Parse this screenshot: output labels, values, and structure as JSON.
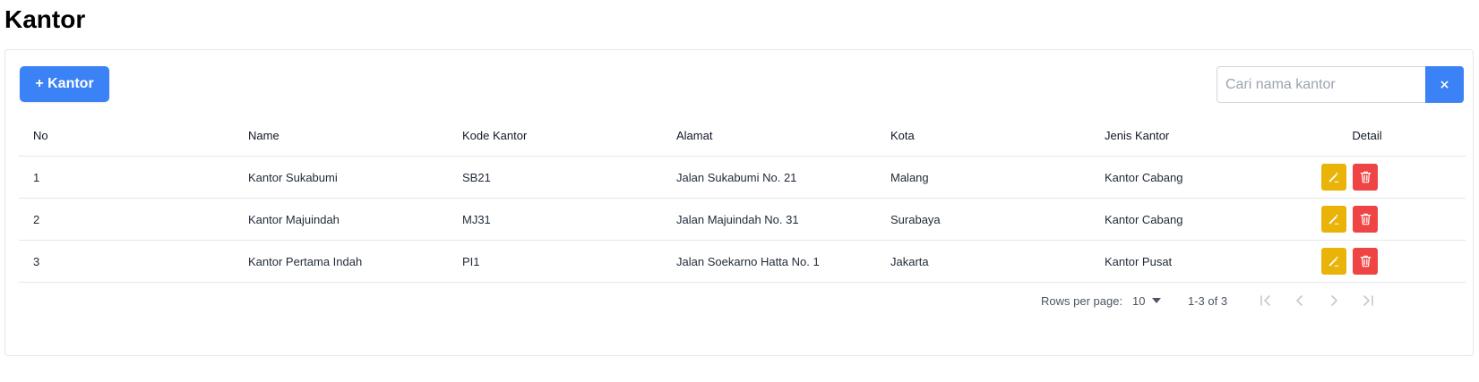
{
  "page": {
    "title": "Kantor"
  },
  "toolbar": {
    "add_label": "+ Kantor"
  },
  "search": {
    "placeholder": "Cari nama kantor",
    "value": "",
    "clear_label": "×"
  },
  "table": {
    "headers": [
      "No",
      "Name",
      "Kode Kantor",
      "Alamat",
      "Kota",
      "Jenis Kantor",
      "Detail"
    ],
    "rows": [
      [
        "1",
        "Kantor Sukabumi",
        "SB21",
        "Jalan Sukabumi No. 21",
        "Malang",
        "Kantor Cabang"
      ],
      [
        "2",
        "Kantor Majuindah",
        "MJ31",
        "Jalan Majuindah No. 31",
        "Surabaya",
        "Kantor Cabang"
      ],
      [
        "3",
        "Kantor Pertama Indah",
        "PI1",
        "Jalan Soekarno Hatta No. 1",
        "Jakarta",
        "Kantor Pusat"
      ]
    ]
  },
  "pagination": {
    "rows_per_page_label": "Rows per page:",
    "rows_per_page_value": "10",
    "range_text": "1-3 of 3"
  },
  "icons": {
    "edit": "edit-icon",
    "delete": "trash-icon",
    "first": "first-page-icon",
    "prev": "chevron-left-icon",
    "next": "chevron-right-icon",
    "last": "last-page-icon",
    "dropdown": "caret-down-icon"
  },
  "colors": {
    "primary": "#3b82f6",
    "edit": "#eab308",
    "delete": "#ef4444",
    "annotation": "#e11d1d"
  }
}
